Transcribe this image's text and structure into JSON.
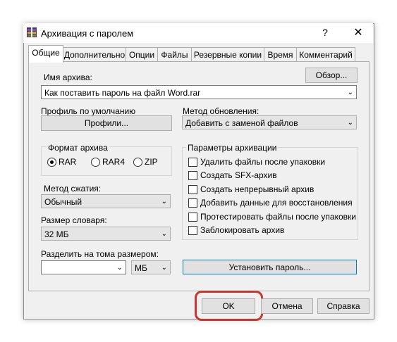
{
  "window": {
    "title": "Архивация с паролем",
    "help_label": "?",
    "close_label": "✕"
  },
  "tabs": [
    {
      "label": "Общие"
    },
    {
      "label": "Дополнительно"
    },
    {
      "label": "Опции"
    },
    {
      "label": "Файлы"
    },
    {
      "label": "Резервные копии"
    },
    {
      "label": "Время"
    },
    {
      "label": "Комментарий"
    }
  ],
  "archive": {
    "name_label": "Имя архива:",
    "browse_label": "Обзор...",
    "name_value": "Как поставить пароль на файл Word.rar"
  },
  "profile": {
    "label": "Профиль по умолчанию",
    "button_label": "Профили..."
  },
  "update": {
    "label": "Метод обновления:",
    "value": "Добавить с заменой файлов"
  },
  "format": {
    "label": "Формат архива",
    "options": [
      "RAR",
      "RAR4",
      "ZIP"
    ],
    "selected": "RAR"
  },
  "params": {
    "label": "Параметры архивации",
    "options": [
      "Удалить файлы после упаковки",
      "Создать SFX-архив",
      "Создать непрерывный архив",
      "Добавить данные для восстановления",
      "Протестировать файлы после упаковки",
      "Заблокировать архив"
    ]
  },
  "compression": {
    "label": "Метод сжатия:",
    "value": "Обычный"
  },
  "dictionary": {
    "label": "Размер словаря:",
    "value": "32 МБ"
  },
  "split": {
    "label": "Разделить на тома размером:",
    "value": "",
    "unit": "МБ"
  },
  "set_password_label": "Установить пароль...",
  "footer": {
    "ok_label": "OK",
    "cancel_label": "Отмена",
    "help_label": "Справка"
  },
  "colors": {
    "highlight": "#c9352f",
    "dialog_bg": "#f0f0f0",
    "focus_border": "#0078d7"
  }
}
